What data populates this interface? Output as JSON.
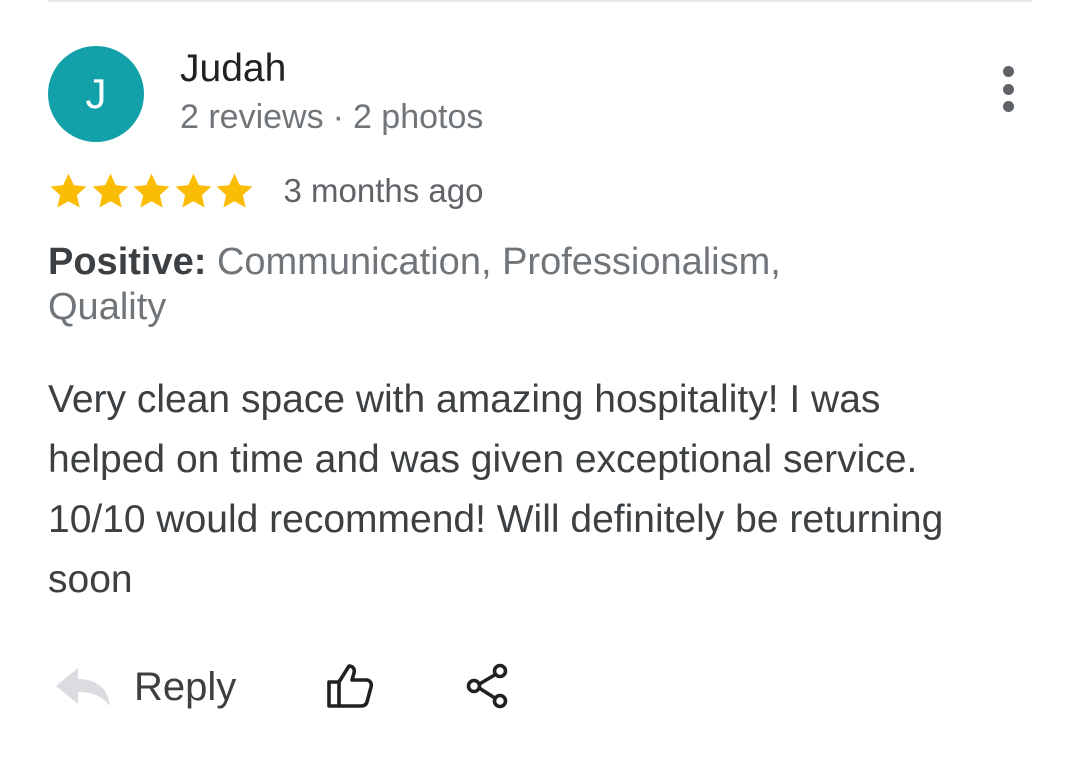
{
  "review": {
    "author": {
      "initial": "J",
      "name": "Judah",
      "reviews_count": "2 reviews",
      "separator": "·",
      "photos_count": "2 photos",
      "avatar_color": "#12a0a9"
    },
    "rating": 5,
    "max_rating": 5,
    "star_color": "#fbbc04",
    "time_ago": "3 months ago",
    "attributes": {
      "label": "Positive:",
      "values": "Communication, Professionalism, Quality"
    },
    "text": "Very clean space with amazing hospitality! I was helped on time and was given exceptional service. 10/10 would recommend! Will definitely be returning soon"
  },
  "actions": {
    "reply_label": "Reply",
    "icons": [
      "reply-arrow-icon",
      "thumbs-up-icon",
      "share-icon",
      "more-vertical-icon"
    ]
  }
}
